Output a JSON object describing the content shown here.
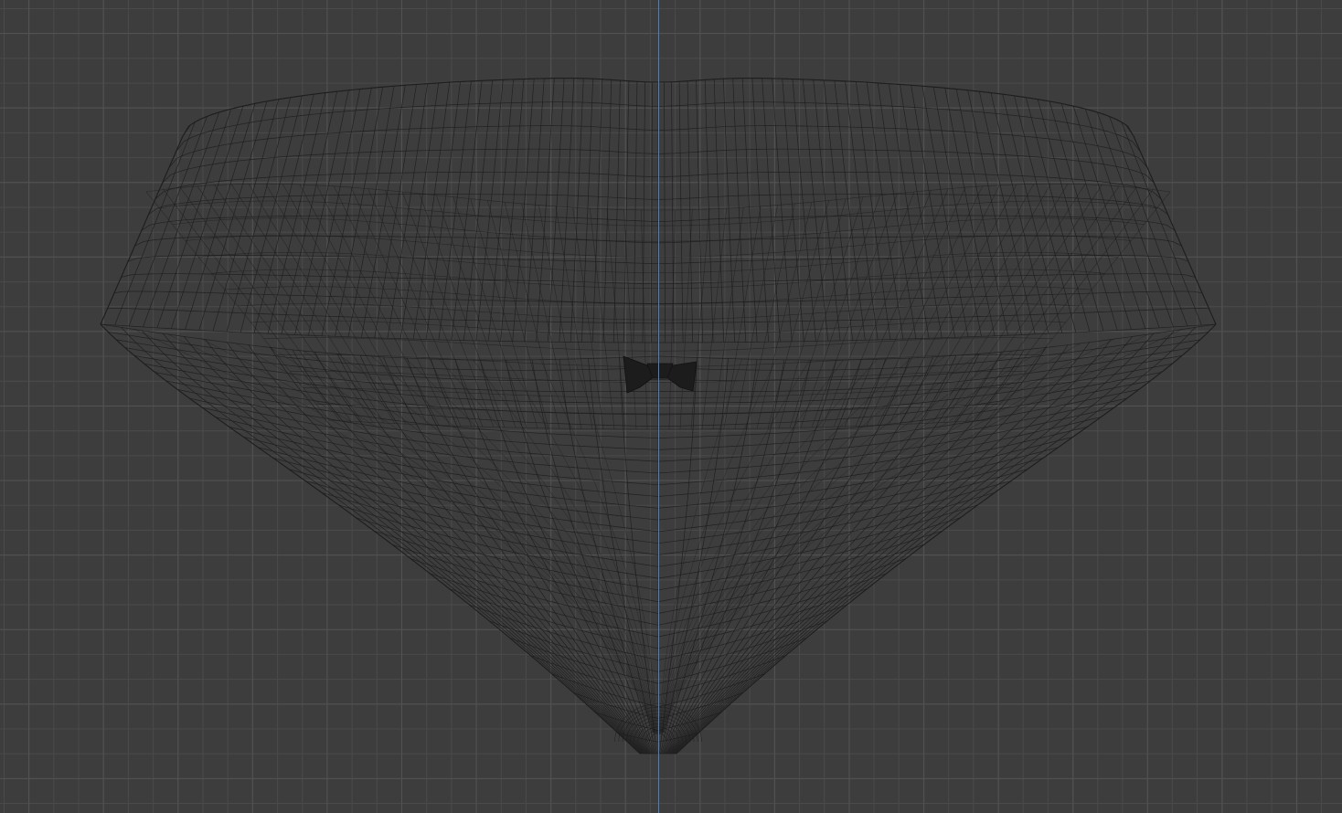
{
  "viewport": {
    "background_color": "#3d3d3d",
    "grid_minor_color": "#4a4a4a",
    "grid_major_color": "#525252",
    "axis_color": "#4a7fc1",
    "wire_color": "#1e1e1e",
    "bow_color": "#1c1c1c"
  },
  "icons": {
    "mesh": "wireframe-mesh-icon",
    "object": "bow-object-icon"
  }
}
